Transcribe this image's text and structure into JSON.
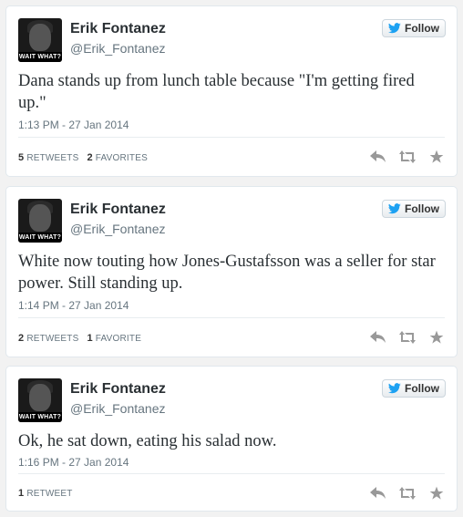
{
  "colors": {
    "twitter_blue": "#1da1f2",
    "icon_gray": "#999999"
  },
  "tweets": [
    {
      "name": "Erik Fontanez",
      "handle": "@Erik_Fontanez",
      "avatar_caption": "WAIT WHAT?",
      "follow_label": "Follow",
      "text": "Dana stands up from lunch table because \"I'm getting fired up.\"",
      "time": "1:13 PM - 27 Jan 2014",
      "stat1_count": "5",
      "stat1_label": "RETWEETS",
      "stat2_count": "2",
      "stat2_label": "FAVORITES"
    },
    {
      "name": "Erik Fontanez",
      "handle": "@Erik_Fontanez",
      "avatar_caption": "WAIT WHAT?",
      "follow_label": "Follow",
      "text": "White now touting how Jones-Gustafsson was a seller for star power. Still standing up.",
      "time": "1:14 PM - 27 Jan 2014",
      "stat1_count": "2",
      "stat1_label": "RETWEETS",
      "stat2_count": "1",
      "stat2_label": "FAVORITE"
    },
    {
      "name": "Erik Fontanez",
      "handle": "@Erik_Fontanez",
      "avatar_caption": "WAIT WHAT?",
      "follow_label": "Follow",
      "text": "Ok, he sat down, eating his salad now.",
      "time": "1:16 PM - 27 Jan 2014",
      "stat1_count": "1",
      "stat1_label": "RETWEET"
    }
  ],
  "icons": {
    "follow": "twitter-bird-icon",
    "reply": "reply-icon",
    "retweet": "retweet-icon",
    "favorite": "star-icon"
  }
}
